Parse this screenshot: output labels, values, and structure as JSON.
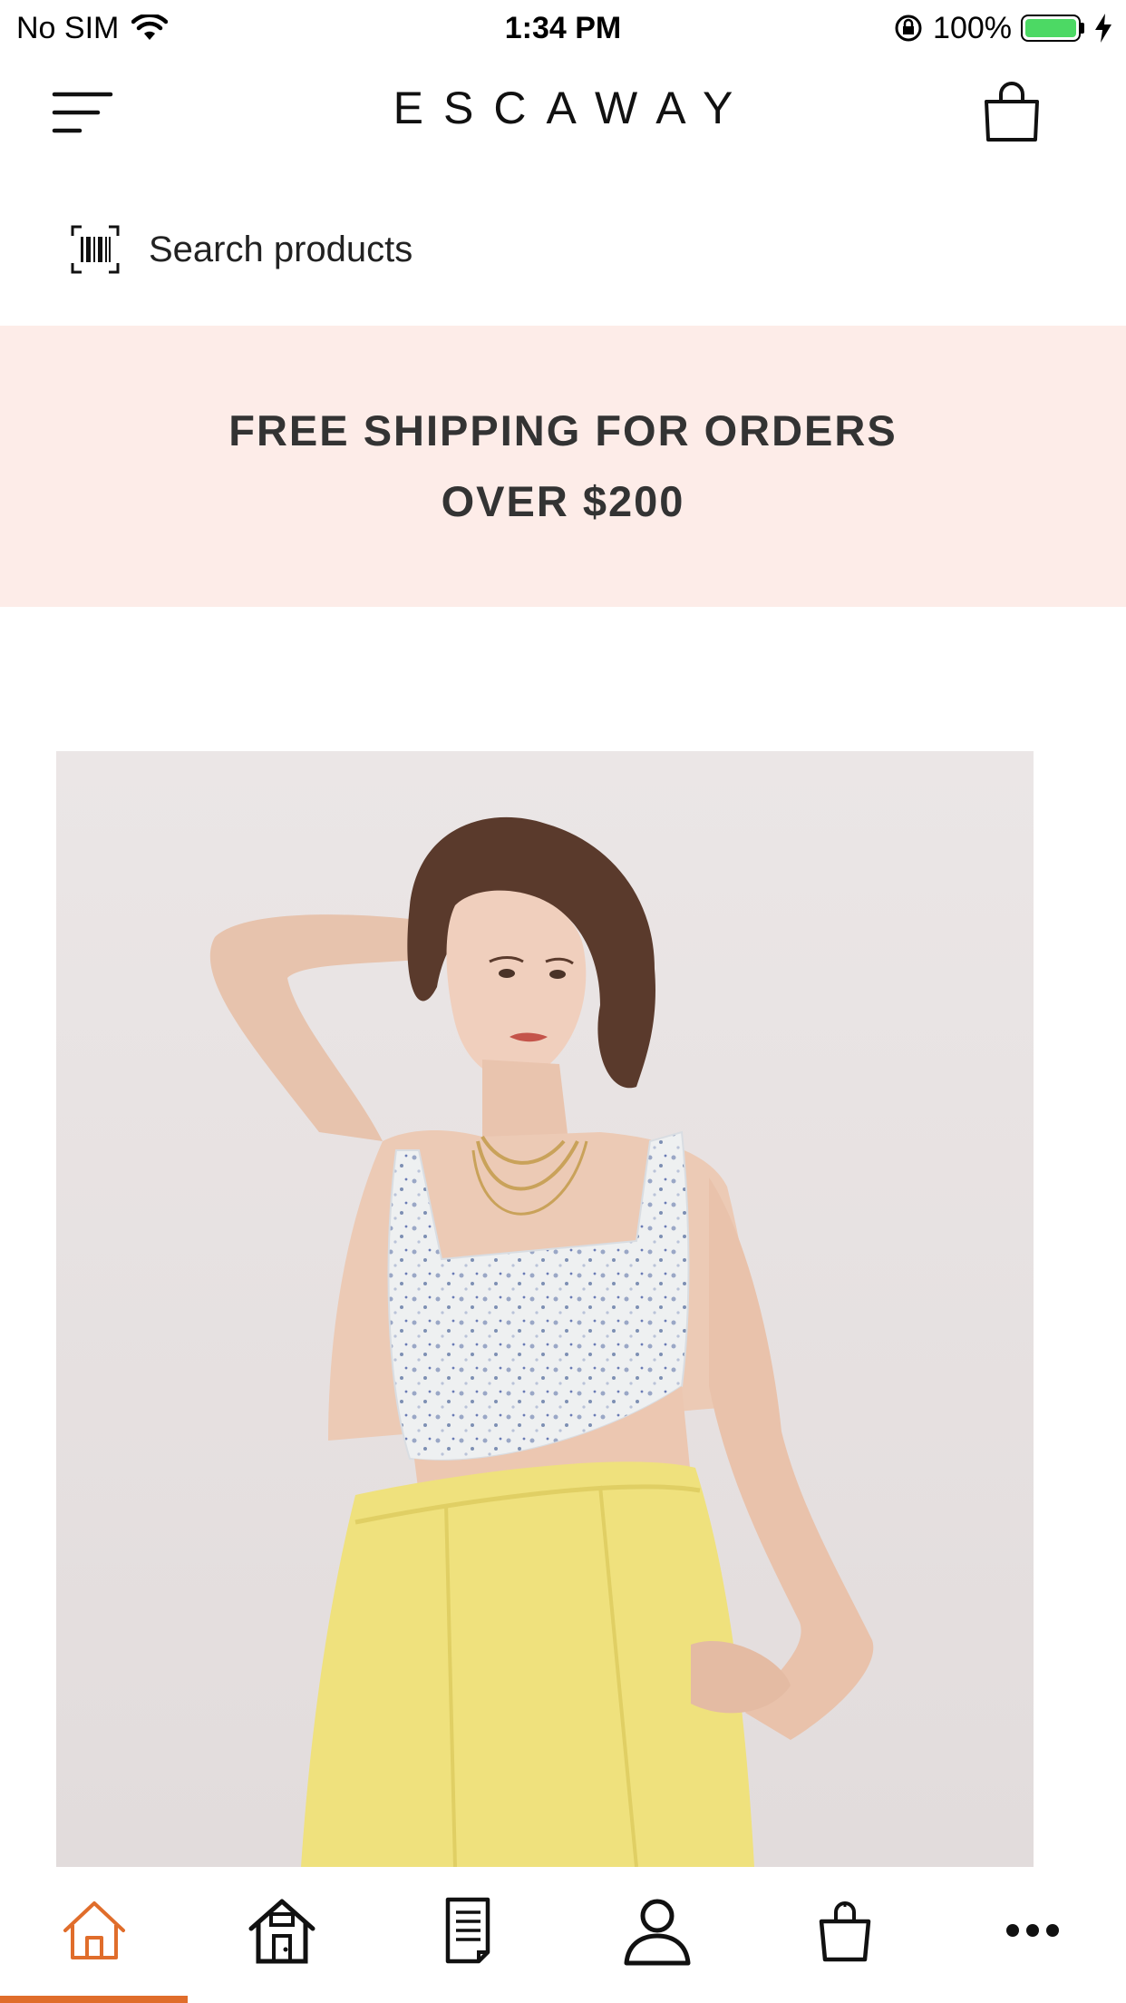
{
  "status_bar": {
    "carrier": "No SIM",
    "time": "1:34 PM",
    "battery": "100%",
    "battery_level": 1.0
  },
  "header": {
    "brand": "ESCAWAY",
    "menu_icon": "hamburger-menu-icon",
    "cart_icon": "shopping-bag-icon"
  },
  "search": {
    "placeholder": "Search products",
    "icon": "barcode-scan-icon"
  },
  "promo": {
    "line1": "FREE SHIPPING FOR ORDERS",
    "line2": "OVER $200"
  },
  "hero": {
    "image": "model-in-floral-crop-top-and-yellow-trousers"
  },
  "tabbar": {
    "active_index": 0,
    "active_color": "#e06d2b",
    "tabs": [
      {
        "icon": "home-icon"
      },
      {
        "icon": "store-icon"
      },
      {
        "icon": "document-icon"
      },
      {
        "icon": "account-icon"
      },
      {
        "icon": "shopping-bag-icon"
      },
      {
        "icon": "more-icon"
      }
    ]
  },
  "colors": {
    "promo_background": "#fdece8",
    "accent": "#e06d2b",
    "battery_green": "#4cd964"
  }
}
